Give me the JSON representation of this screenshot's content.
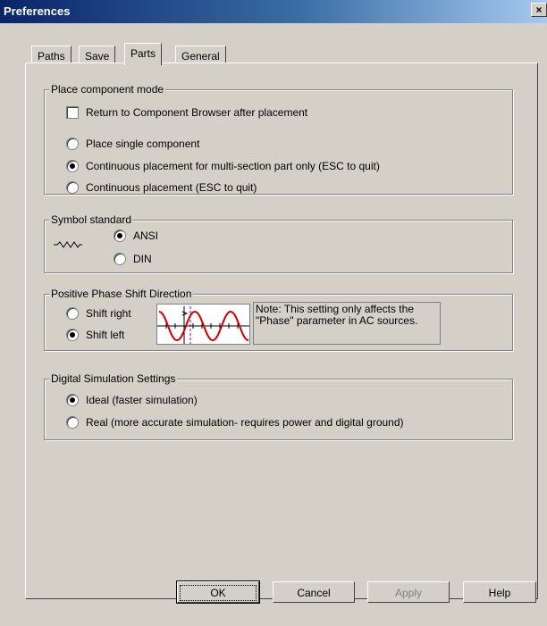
{
  "window": {
    "title": "Preferences",
    "close_glyph": "×"
  },
  "tabs": [
    {
      "label": "Paths"
    },
    {
      "label": "Save"
    },
    {
      "label": "Parts",
      "selected": true
    },
    {
      "label": "General"
    }
  ],
  "place_mode": {
    "legend": "Place component mode",
    "return_checkbox": {
      "label": "Return to Component Browser after placement",
      "checked": false
    },
    "options": [
      {
        "label": "Place single component",
        "selected": false
      },
      {
        "label": "Continuous placement for multi-section part only (ESC to quit)",
        "selected": true
      },
      {
        "label": "Continuous placement (ESC to quit)",
        "selected": false
      }
    ]
  },
  "symbol_standard": {
    "legend": "Symbol standard",
    "icon": "resistor-zigzag-icon",
    "options": [
      {
        "label": "ANSI",
        "selected": true
      },
      {
        "label": "DIN",
        "selected": false
      }
    ]
  },
  "phase_shift": {
    "legend": "Positive Phase Shift Direction",
    "options": [
      {
        "label": "Shift right",
        "selected": false
      },
      {
        "label": "Shift left",
        "selected": true
      }
    ],
    "graph_icon": "sine-wave-phase-icon",
    "note": "Note: This setting only affects the \"Phase\" parameter in AC sources."
  },
  "digital_sim": {
    "legend": "Digital Simulation Settings",
    "options": [
      {
        "label": "Ideal (faster simulation)",
        "selected": true
      },
      {
        "label": "Real (more accurate simulation- requires power and digital ground)",
        "selected": false
      }
    ]
  },
  "buttons": {
    "ok": "OK",
    "cancel": "Cancel",
    "apply": "Apply",
    "help": "Help"
  },
  "colors": {
    "wave": "#cc0000",
    "marker": "#a000a0",
    "title_gradient_start": "#0a246a"
  }
}
